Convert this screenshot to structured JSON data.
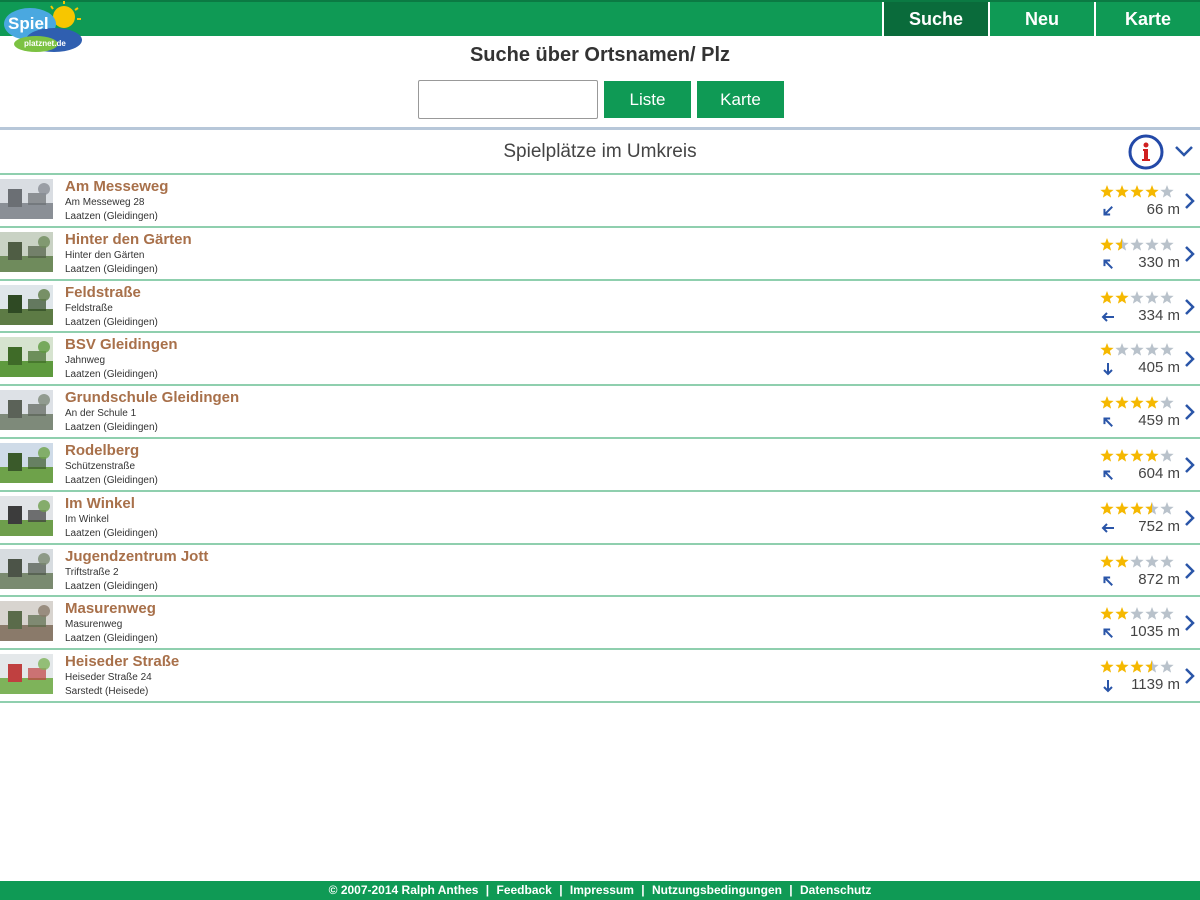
{
  "header": {
    "logo_text_1": "Spiel",
    "logo_text_2": "platznet.de",
    "nav": [
      {
        "label": "Suche",
        "active": true
      },
      {
        "label": "Neu",
        "active": false
      },
      {
        "label": "Karte",
        "active": false
      }
    ]
  },
  "search": {
    "title": "Suche über Ortsnamen/ Plz",
    "input_value": "",
    "btn_liste": "Liste",
    "btn_karte": "Karte"
  },
  "section": {
    "title": "Spielplätze im Umkreis",
    "info_icon": "info-icon",
    "expand_icon": "chevron-down-icon"
  },
  "colors": {
    "green": "#0f9a55",
    "dark_green": "#0a6b3b",
    "name_brown": "#a8704a",
    "star_gold": "#f5b800",
    "star_grey": "#b9c2cb",
    "blue": "#2a55a8"
  },
  "items": [
    {
      "name": "Am Messeweg",
      "street": "Am Messeweg 28",
      "city": "Laatzen (Gleidingen)",
      "rating": 4,
      "distance": "66 m",
      "direction": "sw",
      "thumb": "church"
    },
    {
      "name": "Hinter den Gärten",
      "street": "Hinter den Gärten",
      "city": "Laatzen (Gleidingen)",
      "rating": 1.5,
      "distance": "330 m",
      "direction": "nw",
      "thumb": "yard"
    },
    {
      "name": "Feldstraße",
      "street": "Feldstraße",
      "city": "Laatzen (Gleidingen)",
      "rating": 2,
      "distance": "334 m",
      "direction": "w",
      "thumb": "trees"
    },
    {
      "name": "BSV Gleidingen",
      "street": "Jahnweg",
      "city": "Laatzen (Gleidingen)",
      "rating": 1,
      "distance": "405 m",
      "direction": "s",
      "thumb": "field"
    },
    {
      "name": "Grundschule Gleidingen",
      "street": "An der Schule 1",
      "city": "Laatzen (Gleidingen)",
      "rating": 4,
      "distance": "459 m",
      "direction": "nw",
      "thumb": "school"
    },
    {
      "name": "Rodelberg",
      "street": "Schützenstraße",
      "city": "Laatzen (Gleidingen)",
      "rating": 4,
      "distance": "604 m",
      "direction": "nw",
      "thumb": "hill"
    },
    {
      "name": "Im Winkel",
      "street": "Im Winkel",
      "city": "Laatzen (Gleidingen)",
      "rating": 3.5,
      "distance": "752 m",
      "direction": "w",
      "thumb": "house"
    },
    {
      "name": "Jugendzentrum Jott",
      "street": "Triftstraße 2",
      "city": "Laatzen (Gleidingen)",
      "rating": 2,
      "distance": "872 m",
      "direction": "nw",
      "thumb": "court"
    },
    {
      "name": "Masurenweg",
      "street": "Masurenweg",
      "city": "Laatzen (Gleidingen)",
      "rating": 2,
      "distance": "1035 m",
      "direction": "nw",
      "thumb": "building"
    },
    {
      "name": "Heiseder Straße",
      "street": "Heiseder Straße 24",
      "city": "Sarstedt (Heisede)",
      "rating": 3.5,
      "distance": "1139 m",
      "direction": "s",
      "thumb": "playset"
    }
  ],
  "footer": {
    "copyright": "© 2007-2014 Ralph Anthes",
    "links": [
      "Feedback",
      "Impressum",
      "Nutzungsbedingungen",
      "Datenschutz"
    ],
    "separator": "|"
  }
}
